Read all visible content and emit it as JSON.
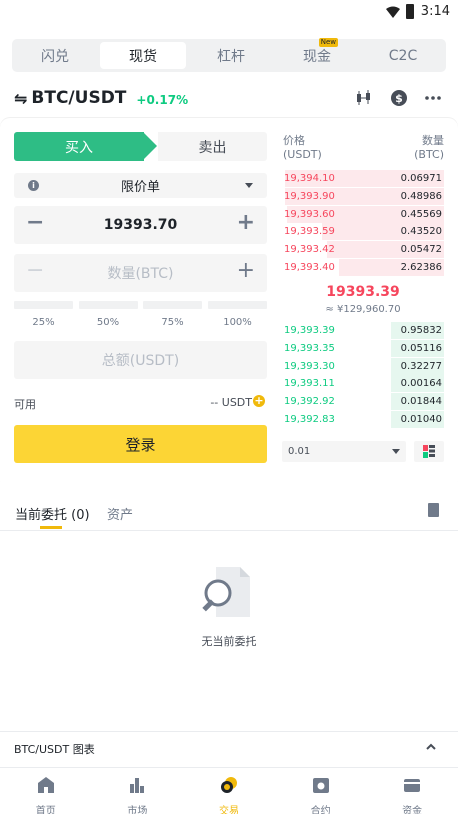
{
  "status_bar": {
    "time": "3:14"
  },
  "top_tabs": [
    {
      "label": "闪兑",
      "active": false
    },
    {
      "label": "现货",
      "active": true
    },
    {
      "label": "杠杆",
      "active": false
    },
    {
      "label": "现金",
      "active": false,
      "badge": "New"
    },
    {
      "label": "C2C",
      "active": false
    }
  ],
  "pair": {
    "symbol": "BTC/USDT",
    "change": "+0.17%"
  },
  "order_form": {
    "buy_label": "买入",
    "sell_label": "卖出",
    "order_type": "限价单",
    "price": "19393.70",
    "qty_placeholder": "数量(BTC)",
    "percents": [
      "25%",
      "50%",
      "75%",
      "100%"
    ],
    "total_placeholder": "总额(USDT)",
    "available_label": "可用",
    "available_value": "-- USDT",
    "login_label": "登录"
  },
  "order_book": {
    "price_header": "价格",
    "price_unit": "(USDT)",
    "qty_header": "数量",
    "qty_unit": "(BTC)",
    "asks": [
      {
        "price": "19,394.10",
        "qty": "0.06971",
        "depth": 0.98
      },
      {
        "price": "19,393.90",
        "qty": "0.48986",
        "depth": 0.98
      },
      {
        "price": "19,393.60",
        "qty": "0.45569",
        "depth": 0.97
      },
      {
        "price": "19,393.59",
        "qty": "0.43520",
        "depth": 0.75
      },
      {
        "price": "19,393.42",
        "qty": "0.05472",
        "depth": 0.72
      },
      {
        "price": "19,393.40",
        "qty": "2.62386",
        "depth": 0.65
      }
    ],
    "last_price": "19393.39",
    "last_price_fiat": "≈ ¥129,960.70",
    "bids": [
      {
        "price": "19,393.39",
        "qty": "0.95832",
        "depth": 0.33
      },
      {
        "price": "19,393.35",
        "qty": "0.05116",
        "depth": 0.33
      },
      {
        "price": "19,393.30",
        "qty": "0.32277",
        "depth": 0.33
      },
      {
        "price": "19,393.11",
        "qty": "0.00164",
        "depth": 0.33
      },
      {
        "price": "19,392.92",
        "qty": "0.01844",
        "depth": 0.33
      },
      {
        "price": "19,392.83",
        "qty": "0.01040",
        "depth": 0.33
      }
    ],
    "depth_precision": "0.01"
  },
  "orders": {
    "tab_open": "当前委托 (0)",
    "tab_assets": "资产",
    "empty_text": "无当前委托"
  },
  "chart_section": {
    "label": "BTC/USDT 图表"
  },
  "bottom_nav": [
    {
      "label": "首页",
      "active": false
    },
    {
      "label": "市场",
      "active": false
    },
    {
      "label": "交易",
      "active": true
    },
    {
      "label": "合约",
      "active": false
    },
    {
      "label": "资金",
      "active": false
    }
  ],
  "colors": {
    "buy": "#2ebd85",
    "sell_text": "#f6465d",
    "bid_text": "#0ecb81",
    "accent": "#fcd535",
    "brand": "#f0b90b"
  }
}
